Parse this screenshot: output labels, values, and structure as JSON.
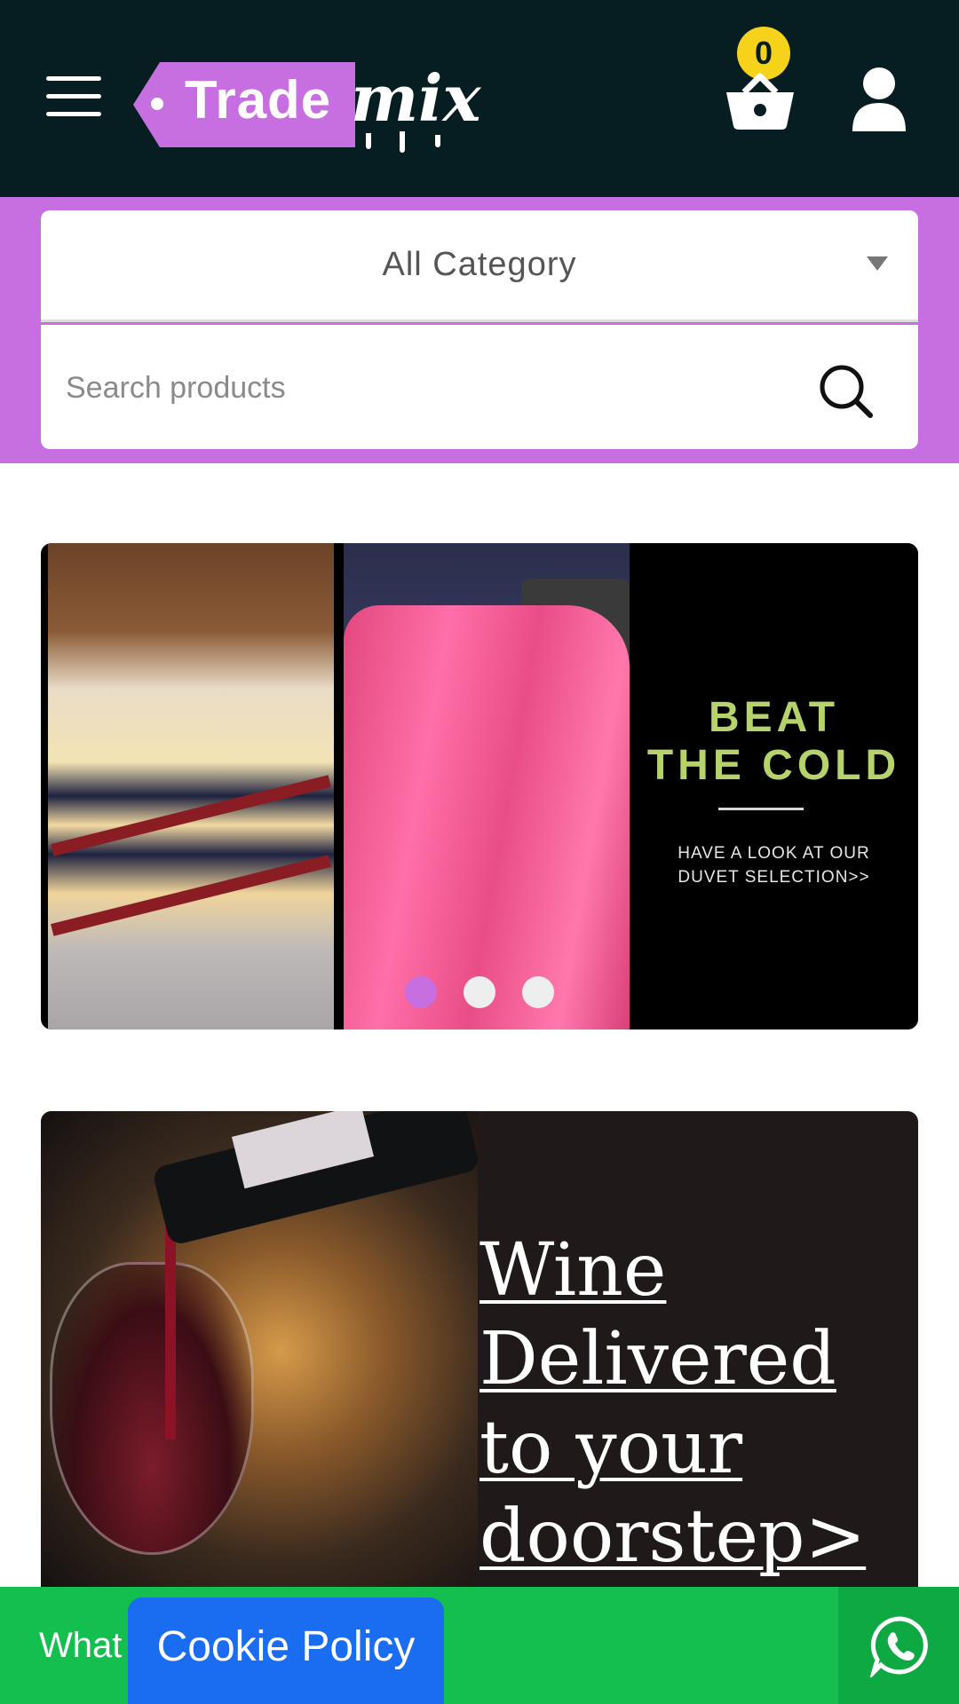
{
  "header": {
    "logo_part1": "Trade",
    "logo_part2": "mix",
    "cart_count": "0",
    "icons": [
      "hamburger-menu-icon",
      "basket-icon",
      "user-icon"
    ]
  },
  "search": {
    "category_selected": "All Category",
    "placeholder": "Search products"
  },
  "banners": [
    {
      "headline_line1": "BEAT",
      "headline_line2": "THE COLD",
      "sub_line1": "HAVE A LOOK AT OUR",
      "sub_line2": "DUVET SELECTION>>",
      "slides": 3,
      "active_slide": 1
    },
    {
      "lines": [
        "Wine",
        "Delivered",
        "to your",
        "doorstep>"
      ]
    }
  ],
  "footer": {
    "whatsapp_label": "What",
    "cookie_label": "Cookie Policy"
  },
  "colors": {
    "header_bg": "#061d21",
    "brand_purple": "#c76fe0",
    "badge_yellow": "#f6d21b",
    "whatsapp_green": "#12bf4f",
    "cookie_blue": "#1a6cf0",
    "beat_green": "#b6d36b"
  }
}
